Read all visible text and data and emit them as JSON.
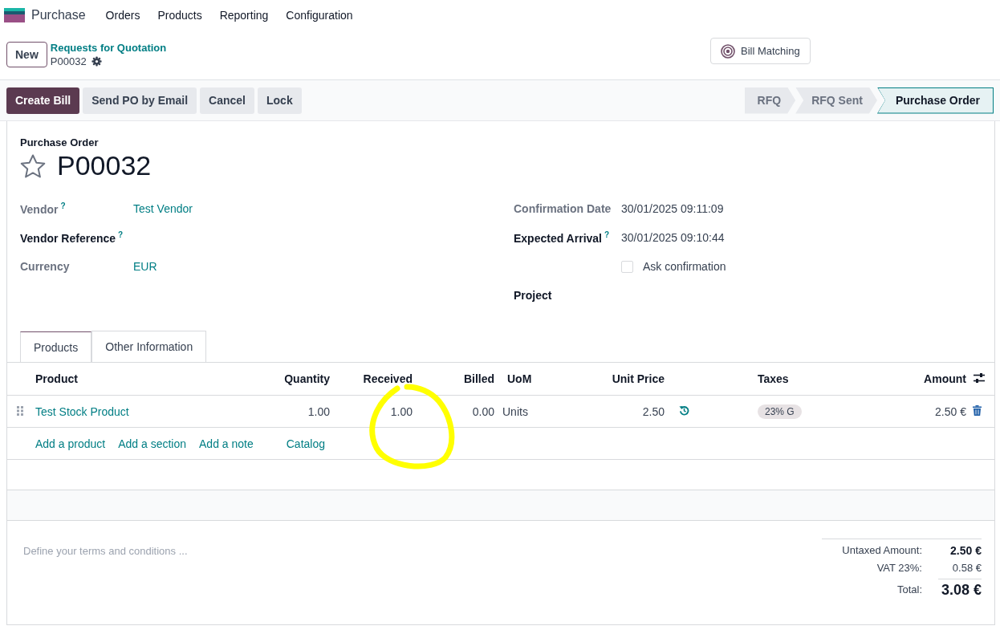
{
  "app": {
    "name": "Purchase"
  },
  "menu": [
    "Orders",
    "Products",
    "Reporting",
    "Configuration"
  ],
  "new_button": "New",
  "breadcrumb": {
    "parent": "Requests for Quotation",
    "current": "P00032"
  },
  "smart_buttons": [
    "Bill Matching"
  ],
  "actions": [
    {
      "label": "Create Bill",
      "primary": true
    },
    {
      "label": "Send PO by Email",
      "primary": false
    },
    {
      "label": "Cancel",
      "primary": false
    },
    {
      "label": "Lock",
      "primary": false
    }
  ],
  "stages": [
    {
      "label": "RFQ",
      "selected": false
    },
    {
      "label": "RFQ Sent",
      "selected": false
    },
    {
      "label": "Purchase Order",
      "selected": true
    }
  ],
  "form": {
    "caption": "Purchase Order",
    "name": "P00032",
    "starred": false,
    "left_fields": [
      {
        "label": "Vendor",
        "help": "?",
        "readonly": true,
        "kind": "link",
        "value": "Test Vendor"
      },
      {
        "label": "Vendor Reference",
        "help": "?",
        "readonly": false,
        "kind": "text"
      },
      {
        "label": "Currency",
        "readonly": true,
        "kind": "link",
        "value": "EUR"
      }
    ],
    "right_fields": [
      {
        "label": "Confirmation Date",
        "readonly": true,
        "kind": "text",
        "value": "30/01/2025 09:11:09"
      },
      {
        "label": "Expected Arrival",
        "help": "?",
        "readonly": false,
        "kind": "text",
        "value": "30/01/2025 09:10:44"
      },
      {
        "kind": "checkbox",
        "value": "Ask confirmation",
        "checked": false
      },
      {
        "label": "Project",
        "readonly": false,
        "kind": "text"
      }
    ]
  },
  "tabs": [
    {
      "label": "Products",
      "selected": true
    },
    {
      "label": "Other Information",
      "selected": false
    }
  ],
  "lines": {
    "columns": [
      "Product",
      "Quantity",
      "Received",
      "Billed",
      "UoM",
      "Unit Price",
      "Taxes",
      "Amount"
    ],
    "rows": [
      {
        "product": "Test Stock Product",
        "quantity": "1.00",
        "received": "1.00",
        "billed": "0.00",
        "uom": "Units",
        "unit_price": "2.50",
        "taxes": [
          "23% G"
        ],
        "amount": "2.50 €"
      }
    ],
    "add_links": [
      "Add a product",
      "Add a section",
      "Add a note",
      "Catalog"
    ]
  },
  "terms": {
    "placeholder": "Define your terms and conditions ..."
  },
  "totals": [
    {
      "label": "Untaxed Amount:",
      "value": "2.50 €",
      "kind": "subtotal"
    },
    {
      "label": "VAT 23%:",
      "value": "0.58 €",
      "kind": "tax"
    },
    {
      "label": "Total:",
      "value": "3.08 €",
      "kind": "total"
    }
  ]
}
